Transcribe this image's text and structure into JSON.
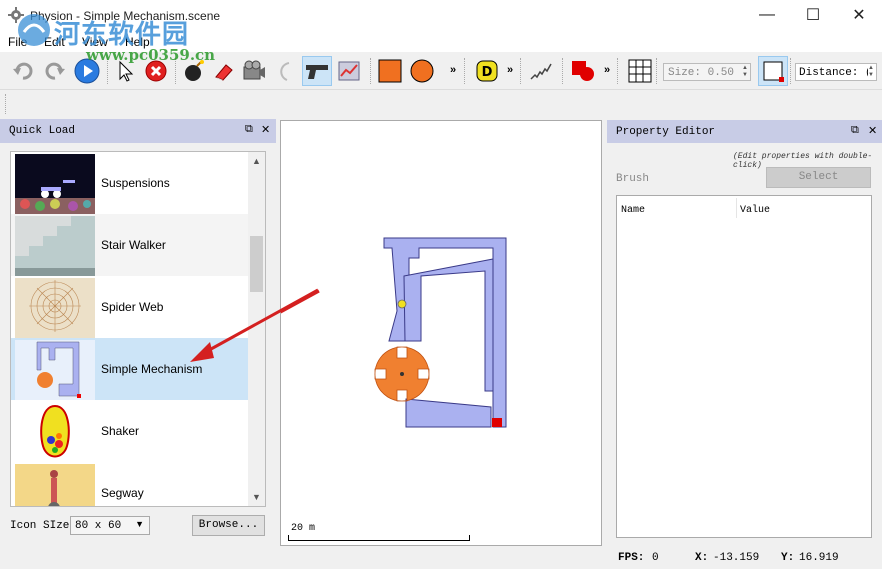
{
  "window": {
    "title": "Physion - Simple Mechanism.scene",
    "minimize": "—",
    "maximize": "☐",
    "close": "✕"
  },
  "watermark": {
    "line1": "河东软件园",
    "line2": "www.pc0359.cn"
  },
  "menu": [
    "File",
    "Edit",
    "View",
    "Help"
  ],
  "toolbar": {
    "icons": [
      "undo-icon",
      "redo-icon",
      "play-icon",
      "pointer-icon",
      "delete-icon",
      "bomb-icon",
      "eraser-icon",
      "camera-icon",
      "rope-icon",
      "gun-icon",
      "graph-icon",
      "rectangle-icon",
      "circle-icon",
      "d-shape-icon",
      "spring-icon",
      "polygon-icon",
      "grid-icon",
      "snap-box-icon"
    ],
    "size_label": "Size: 0.50",
    "distance_label": "Distance: (",
    "overflow": "»"
  },
  "quick_load": {
    "title": "Quick Load",
    "items": [
      {
        "label": "Suspensions"
      },
      {
        "label": "Stair Walker"
      },
      {
        "label": "Spider Web"
      },
      {
        "label": "Simple Mechanism"
      },
      {
        "label": "Shaker"
      },
      {
        "label": "Segway"
      }
    ],
    "selected": "Simple Mechanism",
    "icon_size_label": "Icon SIze",
    "icon_size_value": "80 x 60",
    "browse_label": "Browse..."
  },
  "canvas": {
    "scale_label": "20 m"
  },
  "property_editor": {
    "title": "Property Editor",
    "hint": "(Edit properties with double-click)",
    "brush_label": "Brush",
    "select_label": "Select",
    "col_name": "Name",
    "col_value": "Value"
  },
  "status": {
    "fps_label": "FPS:",
    "fps_value": "0",
    "x_label": "X:",
    "x_value": "-13.159",
    "y_label": "Y:",
    "y_value": "16.919"
  },
  "colors": {
    "panel_header": "#c8cce6",
    "selection": "#cce4f7",
    "shape_fill": "#aab1f0",
    "shape_stroke": "#3a3a88",
    "wheel": "#f08030",
    "red": "#e00000",
    "ball": "#f0e020"
  }
}
